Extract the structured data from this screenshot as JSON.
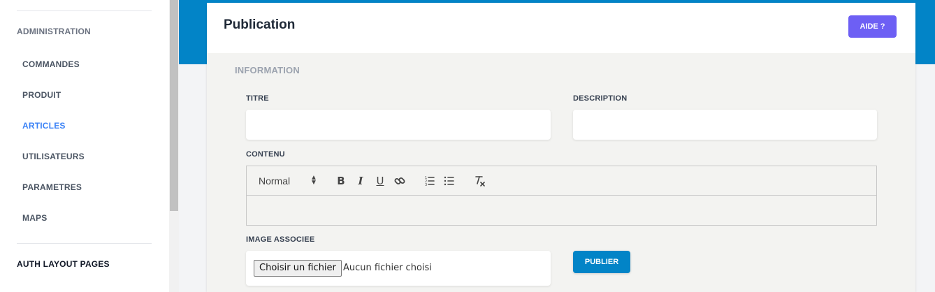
{
  "sidebar": {
    "section_admin": "ADMINISTRATION",
    "items": [
      {
        "label": "COMMANDES"
      },
      {
        "label": "PRODUIT"
      },
      {
        "label": "ARTICLES",
        "active": true
      },
      {
        "label": "UTILISATEURS"
      },
      {
        "label": "PARAMETRES"
      },
      {
        "label": "MAPS"
      }
    ],
    "section_auth": "AUTH LAYOUT PAGES"
  },
  "colors": {
    "accent_blue": "#0284c7",
    "help_purple": "#6d5ff4",
    "active_link": "#3b82f6"
  },
  "card": {
    "title": "Publication",
    "help_button": "AIDE ?"
  },
  "form": {
    "section": "INFORMATION",
    "title_label": "TITRE",
    "title_value": "",
    "description_label": "DESCRIPTION",
    "description_value": "",
    "content_label": "CONTENU",
    "editor": {
      "format_select": "Normal",
      "tools": [
        "bold-icon",
        "italic-icon",
        "underline-icon",
        "link-icon",
        "ordered-list-icon",
        "bullet-list-icon",
        "clear-format-icon"
      ]
    },
    "image_label": "IMAGE ASSOCIEE",
    "file_button": "Choisir un fichier",
    "file_status": "Aucun fichier choisi",
    "publish_button": "PUBLIER"
  }
}
